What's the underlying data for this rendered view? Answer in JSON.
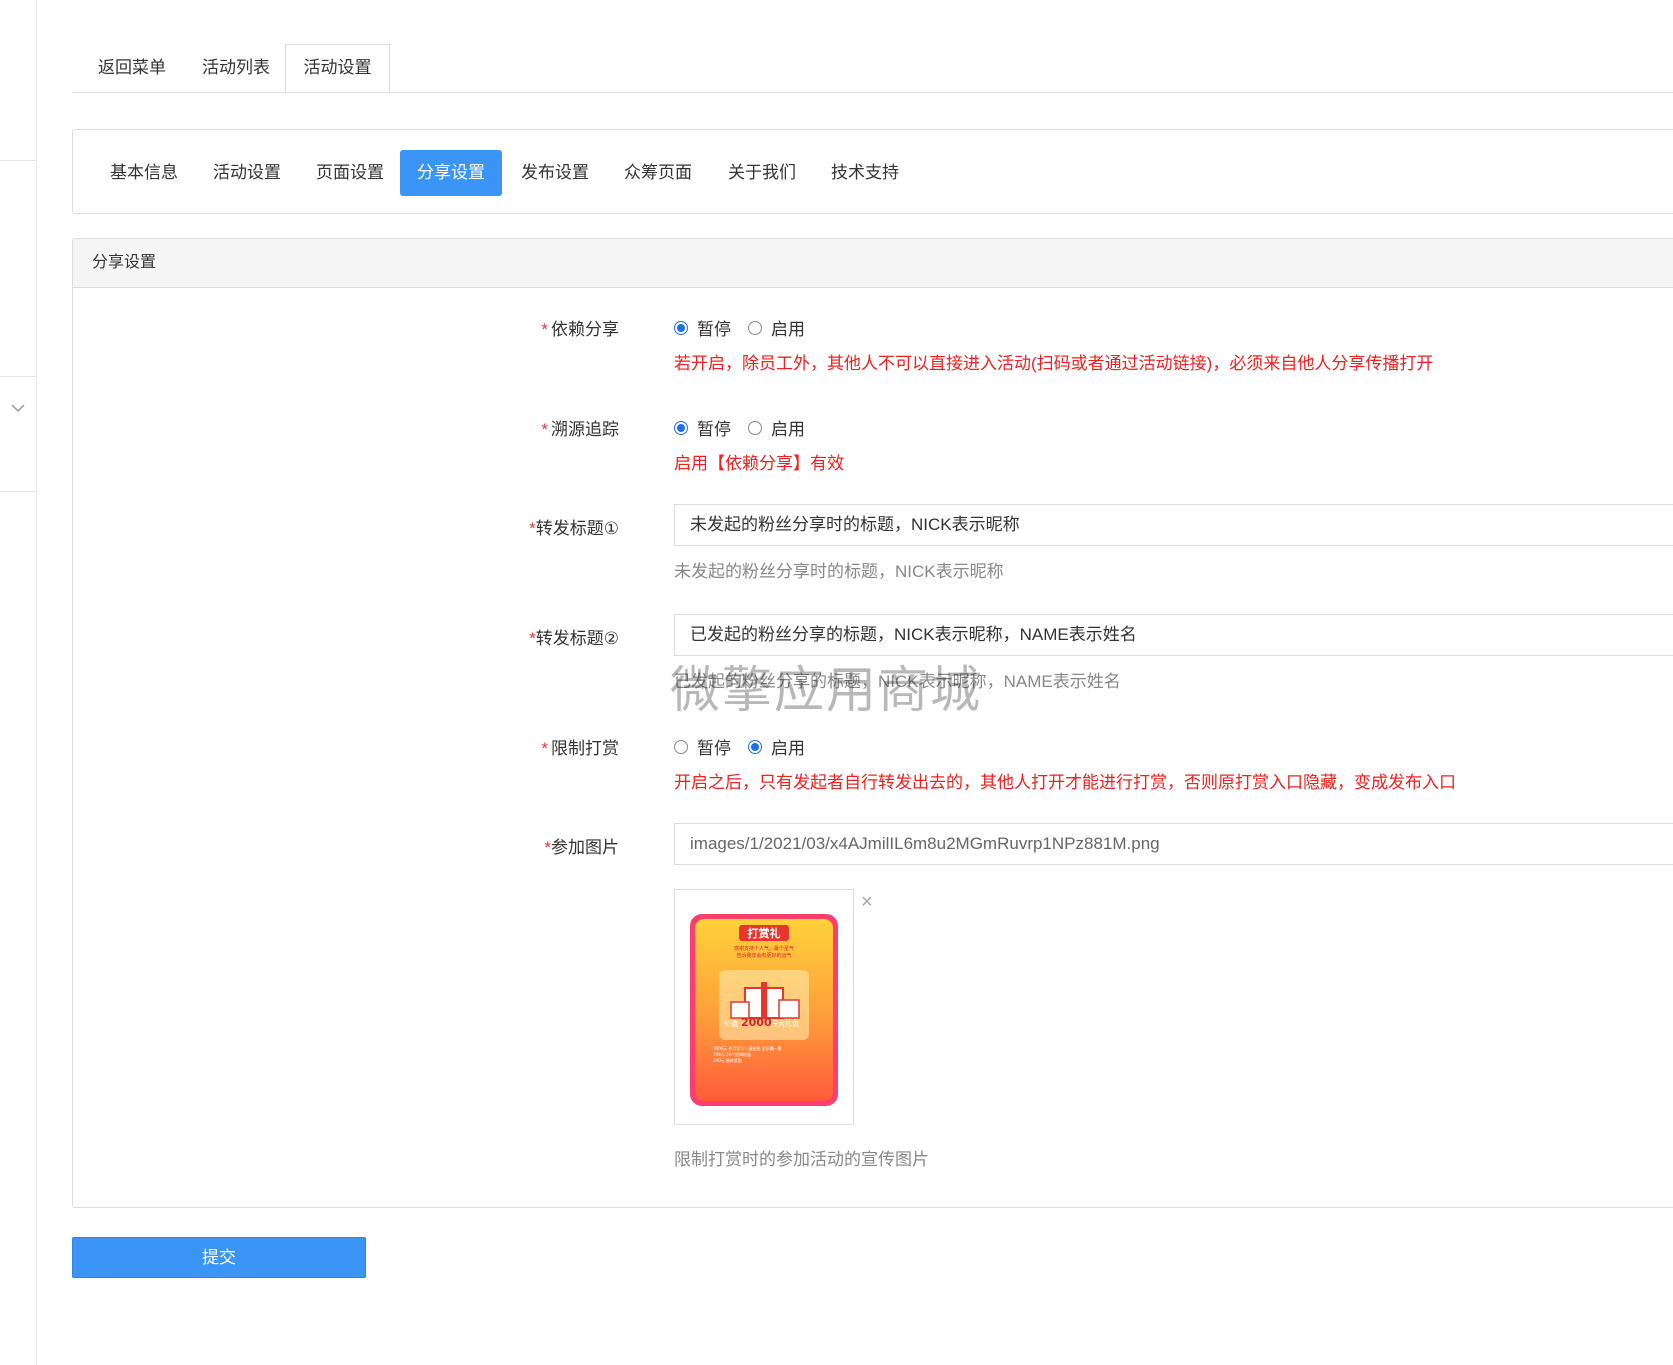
{
  "top_tabs": [
    {
      "label": "返回菜单",
      "active": false
    },
    {
      "label": "活动列表",
      "active": false
    },
    {
      "label": "活动设置",
      "active": true
    }
  ],
  "sub_nav": [
    {
      "label": "基本信息",
      "active": false
    },
    {
      "label": "活动设置",
      "active": false
    },
    {
      "label": "页面设置",
      "active": false
    },
    {
      "label": "分享设置",
      "active": true
    },
    {
      "label": "发布设置",
      "active": false
    },
    {
      "label": "众筹页面",
      "active": false
    },
    {
      "label": "关于我们",
      "active": false
    },
    {
      "label": "技术支持",
      "active": false
    }
  ],
  "panel": {
    "title": "分享设置",
    "rely_share": {
      "label": "依赖分享",
      "options": [
        "暂停",
        "启用"
      ],
      "selected": "暂停",
      "help": "若开启，除员工外，其他人不可以直接进入活动(扫码或者通过活动链接)，必须来自他人分享传播打开"
    },
    "trace": {
      "label": "溯源追踪",
      "options": [
        "暂停",
        "启用"
      ],
      "selected": "暂停",
      "help": "启用【依赖分享】有效"
    },
    "share_title_1": {
      "label": "转发标题①",
      "value": "未发起的粉丝分享时的标题，NICK表示昵称",
      "help": "未发起的粉丝分享时的标题，NICK表示昵称"
    },
    "share_title_2": {
      "label": "转发标题②",
      "value": "已发起的粉丝分享的标题，NICK表示昵称，NAME表示姓名",
      "help": "已发起的粉丝分享的标题，NICK表示昵称，NAME表示姓名"
    },
    "limit_reward": {
      "label": "限制打赏",
      "options": [
        "暂停",
        "启用"
      ],
      "selected": "启用",
      "help": "开启之后，只有发起者自行转发出去的，其他人打开才能进行打赏，否则原打赏入口隐藏，变成发布入口"
    },
    "join_image": {
      "label": "参加图片",
      "value": "images/1/2021/03/x4AJmilIL6m8u2MGmRuvrp1NPz881M.png",
      "help": "限制打赏时的参加活动的宣传图片",
      "close_glyph": "×"
    }
  },
  "poster": {
    "title": "打赏礼",
    "line1": "感谢支持个人气，最个星气",
    "line2": "告诉我年会有更好的运气",
    "price_prefix": "价值",
    "price": "2000",
    "price_suffix": "元大礼包",
    "list1": "1000元 任月学习儿童绘画 全家桶一套",
    "list2": "199元  10个经典绘画",
    "list3": "200元  最终奖励"
  },
  "watermark": "微擎应用商城",
  "submit_label": "提交",
  "colors": {
    "accent": "#3a95f6",
    "error": "#e22222",
    "radio": "#1e6fe6"
  }
}
